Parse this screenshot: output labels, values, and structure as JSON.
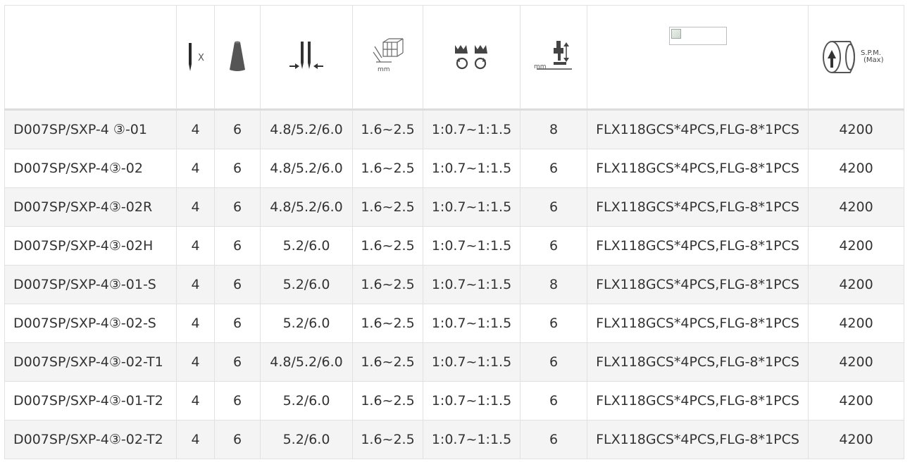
{
  "header": {
    "icons": [
      {
        "name": "needle-icon",
        "text": "X"
      },
      {
        "name": "thread-cone-icon"
      },
      {
        "name": "needle-gauge-icon"
      },
      {
        "name": "stitch-length-icon",
        "text": "mm"
      },
      {
        "name": "differential-feed-icon"
      },
      {
        "name": "presser-foot-lift-icon",
        "text": "mm"
      },
      {
        "name": "broken-image-icon"
      },
      {
        "name": "spm-icon",
        "text": "S.P.M.",
        "text2": "(Max)"
      }
    ]
  },
  "rows": [
    {
      "model": "D007SP/SXP-4 ③-01",
      "needles": "4",
      "threads": "6",
      "gauge": "4.8/5.2/6.0",
      "stitch": "1.6~2.5",
      "diff": "1:0.7~1:1.5",
      "lift": "8",
      "parts": "FLX118GCS*4PCS,FLG-8*1PCS",
      "spm": "4200"
    },
    {
      "model": "D007SP/SXP-4③-02",
      "needles": "4",
      "threads": "6",
      "gauge": "4.8/5.2/6.0",
      "stitch": "1.6~2.5",
      "diff": "1:0.7~1:1.5",
      "lift": "6",
      "parts": "FLX118GCS*4PCS,FLG-8*1PCS",
      "spm": "4200"
    },
    {
      "model": "D007SP/SXP-4③-02R",
      "needles": "4",
      "threads": "6",
      "gauge": "4.8/5.2/6.0",
      "stitch": "1.6~2.5",
      "diff": "1:0.7~1:1.5",
      "lift": "6",
      "parts": "FLX118GCS*4PCS,FLG-8*1PCS",
      "spm": "4200"
    },
    {
      "model": "D007SP/SXP-4③-02H",
      "needles": "4",
      "threads": "6",
      "gauge": "5.2/6.0",
      "stitch": "1.6~2.5",
      "diff": "1:0.7~1:1.5",
      "lift": "6",
      "parts": "FLX118GCS*4PCS,FLG-8*1PCS",
      "spm": "4200"
    },
    {
      "model": "D007SP/SXP-4③-01-S",
      "needles": "4",
      "threads": "6",
      "gauge": "5.2/6.0",
      "stitch": "1.6~2.5",
      "diff": "1:0.7~1:1.5",
      "lift": "8",
      "parts": "FLX118GCS*4PCS,FLG-8*1PCS",
      "spm": "4200"
    },
    {
      "model": "D007SP/SXP-4③-02-S",
      "needles": "4",
      "threads": "6",
      "gauge": "5.2/6.0",
      "stitch": "1.6~2.5",
      "diff": "1:0.7~1:1.5",
      "lift": "6",
      "parts": "FLX118GCS*4PCS,FLG-8*1PCS",
      "spm": "4200"
    },
    {
      "model": "D007SP/SXP-4③-02-T1",
      "needles": "4",
      "threads": "6",
      "gauge": "4.8/5.2/6.0",
      "stitch": "1.6~2.5",
      "diff": "1:0.7~1:1.5",
      "lift": "6",
      "parts": "FLX118GCS*4PCS,FLG-8*1PCS",
      "spm": "4200"
    },
    {
      "model": "D007SP/SXP-4③-01-T2",
      "needles": "4",
      "threads": "6",
      "gauge": "5.2/6.0",
      "stitch": "1.6~2.5",
      "diff": "1:0.7~1:1.5",
      "lift": "6",
      "parts": "FLX118GCS*4PCS,FLG-8*1PCS",
      "spm": "4200"
    },
    {
      "model": "D007SP/SXP-4③-02-T2",
      "needles": "4",
      "threads": "6",
      "gauge": "5.2/6.0",
      "stitch": "1.6~2.5",
      "diff": "1:0.7~1:1.5",
      "lift": "6",
      "parts": "FLX118GCS*4PCS,FLG-8*1PCS",
      "spm": "4200"
    }
  ]
}
